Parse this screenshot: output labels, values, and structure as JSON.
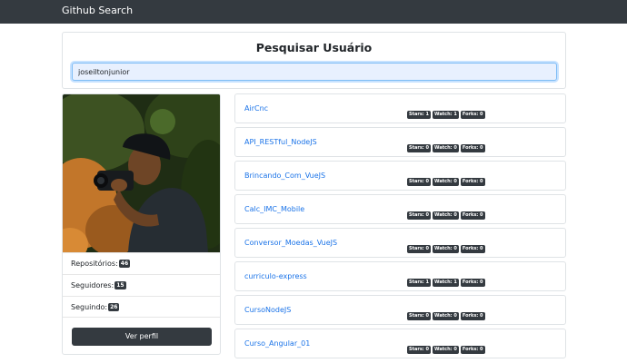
{
  "navbar": {
    "brand": "Github Search"
  },
  "search": {
    "title": "Pesquisar Usuário",
    "value": "joseiltonjunior"
  },
  "profile": {
    "stats": [
      {
        "label": "Repositórios:",
        "count": "46"
      },
      {
        "label": "Seguidores:",
        "count": "15"
      },
      {
        "label": "Seguindo:",
        "count": "26"
      }
    ],
    "button_label": "Ver perfil"
  },
  "repos": [
    {
      "name": "AirCnc",
      "stars": "Stars: 1",
      "watch": "Watch: 1",
      "forks": "Forks: 0"
    },
    {
      "name": "API_RESTful_NodeJS",
      "stars": "Stars: 0",
      "watch": "Watch: 0",
      "forks": "Forks: 0"
    },
    {
      "name": "Brincando_Com_VueJS",
      "stars": "Stars: 0",
      "watch": "Watch: 0",
      "forks": "Forks: 0"
    },
    {
      "name": "Calc_IMC_Mobile",
      "stars": "Stars: 0",
      "watch": "Watch: 0",
      "forks": "Forks: 0"
    },
    {
      "name": "Conversor_Moedas_VueJS",
      "stars": "Stars: 0",
      "watch": "Watch: 0",
      "forks": "Forks: 0"
    },
    {
      "name": "curriculo-express",
      "stars": "Stars: 1",
      "watch": "Watch: 1",
      "forks": "Forks: 0"
    },
    {
      "name": "CursoNodeJS",
      "stars": "Stars: 0",
      "watch": "Watch: 0",
      "forks": "Forks: 0"
    },
    {
      "name": "Curso_Angular_01",
      "stars": "Stars: 0",
      "watch": "Watch: 0",
      "forks": "Forks: 0"
    }
  ],
  "colors": {
    "navbar": "#343a40",
    "link": "#1a73e8",
    "badge": "#343a40",
    "input_bg": "#e8f0fe"
  }
}
